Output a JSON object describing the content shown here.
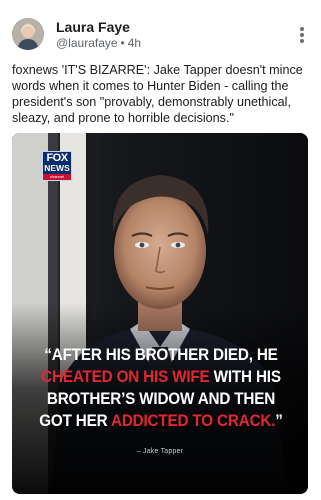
{
  "post": {
    "author_name": "Laura Faye",
    "handle": "@laurafaye",
    "time": "4h",
    "separator": "•",
    "text": "foxnews 'IT'S BIZARRE': Jake Tapper doesn't mince words when it comes to Hunter Biden - calling the president's son \"provably, demonstrably unethical, sleazy, and prone to horrible decisions.\""
  },
  "media": {
    "logo_line1": "FOX",
    "logo_line2": "NEWS",
    "logo_line3": "channel",
    "quote_part1": "“AFTER HIS BROTHER DIED, HE ",
    "quote_red1": "CHEATED ON HIS WIFE",
    "quote_part2": " WITH HIS BROTHER’S WIDOW AND THEN GOT HER ",
    "quote_red2": "ADDICTED TO CRACK.",
    "quote_part3": "”",
    "attribution": "– Jake Tapper"
  },
  "colors": {
    "accent_red": "#e4262f",
    "fox_blue": "#0b2d6b",
    "text": "#1b1d1f",
    "muted": "#60666d"
  },
  "icons": {
    "menu": "more-vertical-icon",
    "avatar": "user-avatar"
  }
}
